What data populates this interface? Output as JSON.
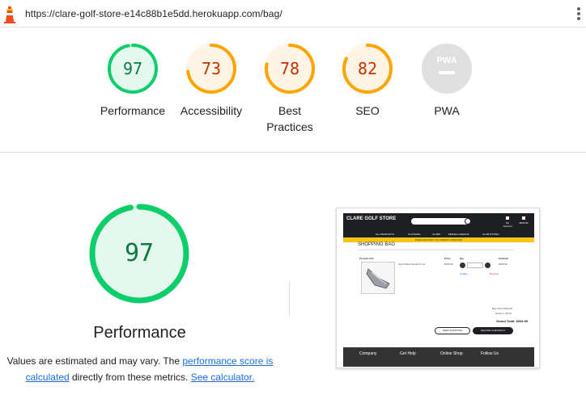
{
  "url_bar": {
    "url": "https://clare-golf-store-e14c88b1e5dd.herokuapp.com/bag/"
  },
  "gauges": [
    {
      "score": "97",
      "label": "Performance",
      "color": "#0cce6b",
      "fill": "#e5f8ee",
      "text_color": "#0a7a3f",
      "fraction": 0.97
    },
    {
      "score": "73",
      "label": "Accessibility",
      "color": "#ffa400",
      "fill": "#fff4e5",
      "text_color": "#c33300",
      "fraction": 0.73
    },
    {
      "score": "78",
      "label": "Best Practices",
      "color": "#ffa400",
      "fill": "#fff4e5",
      "text_color": "#c33300",
      "fraction": 0.78
    },
    {
      "score": "82",
      "label": "SEO",
      "color": "#ffa400",
      "fill": "#fff4e5",
      "text_color": "#c33300",
      "fraction": 0.82
    },
    {
      "score": "PWA",
      "label": "PWA",
      "color": "#e0e0e0",
      "fill": "#e0e0e0",
      "text_color": "#ffffff",
      "fraction": 0
    }
  ],
  "main": {
    "score": "97",
    "fraction": 0.97,
    "title": "Performance",
    "desc_prefix": "Values are estimated and may vary. The ",
    "link1": "performance score is calculated",
    "desc_middle": " directly from these metrics. ",
    "link2": "See calculator."
  },
  "thumbnail": {
    "brand": "CLARE GOLF STORE",
    "nav": [
      "ALL PRODUCTS",
      "CLOTHING",
      "CLUBS",
      "MISCELLANEOUS",
      "CLUB FITTING"
    ],
    "banner": "FREE DELIVERY ON ORDERS OVER $50!",
    "title": "SHOPPING BAG",
    "col_product": "Product Info",
    "col_price": "Price",
    "col_qty": "Qty",
    "col_subtotal": "Subtotal",
    "product_name": "TaylorMade Stealth Irons",
    "price": "$549.99",
    "subtotal": "$549.99",
    "update": "Update",
    "remove": "Remove",
    "bag_total": "Bag Total: $549.99",
    "delivery": "Delivery: $0.00",
    "grand_total": "Grand Total: $549.99",
    "keep_shopping": "KEEP SHOPPING",
    "secure_checkout": "SECURE CHECKOUT",
    "footer_cols": [
      "Company",
      "Get Help",
      "Online Shop",
      "Follow Us"
    ]
  }
}
